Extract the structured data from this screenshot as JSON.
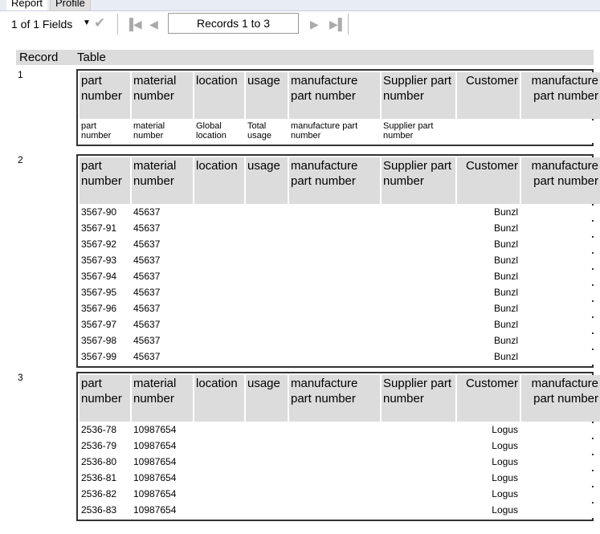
{
  "tabs": [
    "Report",
    "Profile"
  ],
  "toolbar": {
    "fields": "1 of 1 Fields",
    "records": "Records 1 to 3"
  },
  "header": {
    "record": "Record",
    "table": "Table"
  },
  "columns": [
    "part number",
    "material number",
    "location",
    "usage",
    "manufacture part number",
    "Supplier part number",
    "Customer",
    "manufacture part number"
  ],
  "records": [
    {
      "id": "1",
      "rows": [
        [
          "part number",
          "material number",
          "Global location",
          "Total usage",
          "manufacture part number",
          "Supplier part number",
          "",
          ""
        ]
      ]
    },
    {
      "id": "2",
      "rows": [
        [
          "3567-90",
          "45637",
          "",
          "",
          "",
          "",
          "Bunzl",
          ""
        ],
        [
          "3567-91",
          "45637",
          "",
          "",
          "",
          "",
          "Bunzl",
          ""
        ],
        [
          "3567-92",
          "45637",
          "",
          "",
          "",
          "",
          "Bunzl",
          ""
        ],
        [
          "3567-93",
          "45637",
          "",
          "",
          "",
          "",
          "Bunzl",
          ""
        ],
        [
          "3567-94",
          "45637",
          "",
          "",
          "",
          "",
          "Bunzl",
          ""
        ],
        [
          "3567-95",
          "45637",
          "",
          "",
          "",
          "",
          "Bunzl",
          ""
        ],
        [
          "3567-96",
          "45637",
          "",
          "",
          "",
          "",
          "Bunzl",
          ""
        ],
        [
          "3567-97",
          "45637",
          "",
          "",
          "",
          "",
          "Bunzl",
          ""
        ],
        [
          "3567-98",
          "45637",
          "",
          "",
          "",
          "",
          "Bunzl",
          ""
        ],
        [
          "3567-99",
          "45637",
          "",
          "",
          "",
          "",
          "Bunzl",
          ""
        ]
      ]
    },
    {
      "id": "3",
      "rows": [
        [
          "2536-78",
          "10987654",
          "",
          "",
          "",
          "",
          "Logus",
          ""
        ],
        [
          "2536-79",
          "10987654",
          "",
          "",
          "",
          "",
          "Logus",
          ""
        ],
        [
          "2536-80",
          "10987654",
          "",
          "",
          "",
          "",
          "Logus",
          ""
        ],
        [
          "2536-81",
          "10987654",
          "",
          "",
          "",
          "",
          "Logus",
          ""
        ],
        [
          "2536-82",
          "10987654",
          "",
          "",
          "",
          "",
          "Logus",
          ""
        ],
        [
          "2536-83",
          "10987654",
          "",
          "",
          "",
          "",
          "Logus",
          ""
        ]
      ]
    }
  ]
}
